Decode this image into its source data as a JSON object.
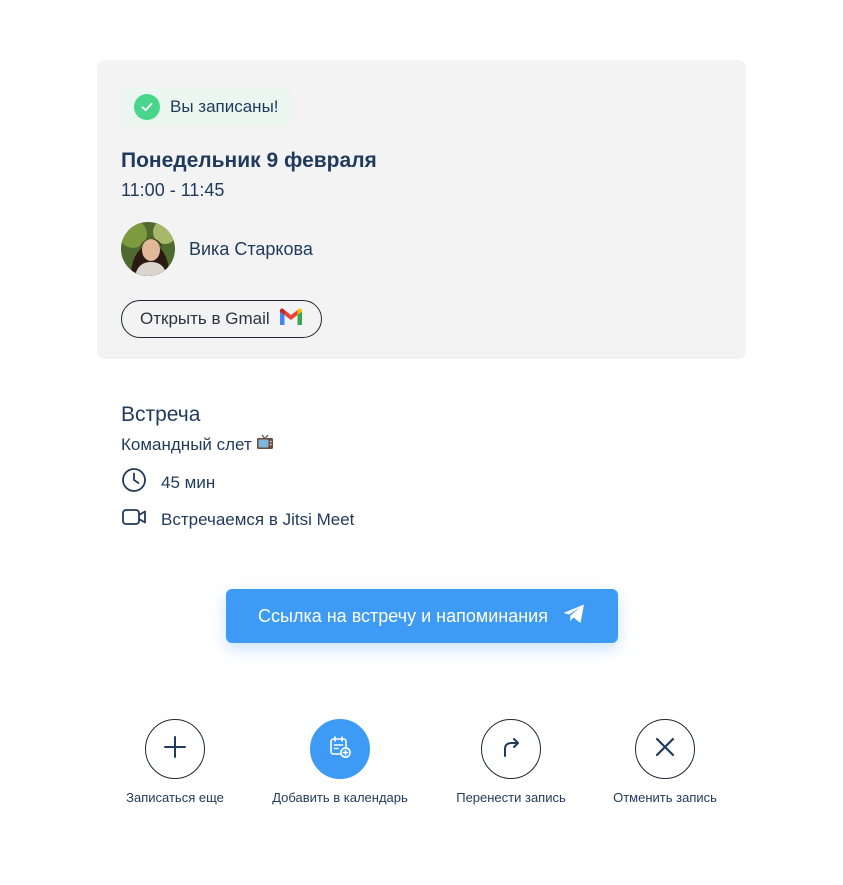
{
  "booking": {
    "status": "Вы записаны!",
    "date": "Понедельник 9 февраля",
    "time": "11:00 - 11:45",
    "host_name": "Вика Старкова",
    "gmail_button": "Открыть в Gmail"
  },
  "event": {
    "type_label": "Встреча",
    "name": "Командный слет",
    "duration": "45 мин",
    "location": "Встречаемся в Jitsi Meet"
  },
  "telegram_button": {
    "label": "Ссылка на встречу и напоминания"
  },
  "actions": [
    {
      "label": "Записаться еще",
      "icon": "plus-icon"
    },
    {
      "label": "Добавить в календарь",
      "icon": "calendar-add-icon"
    },
    {
      "label": "Перенести запись",
      "icon": "redirect-arrow-icon"
    },
    {
      "label": "Отменить запись",
      "icon": "close-icon"
    }
  ],
  "colors": {
    "accent": "#3d9bf5",
    "success": "#4ad68a",
    "card_background": "#f3f3f4",
    "text": "#1f3a5a"
  }
}
